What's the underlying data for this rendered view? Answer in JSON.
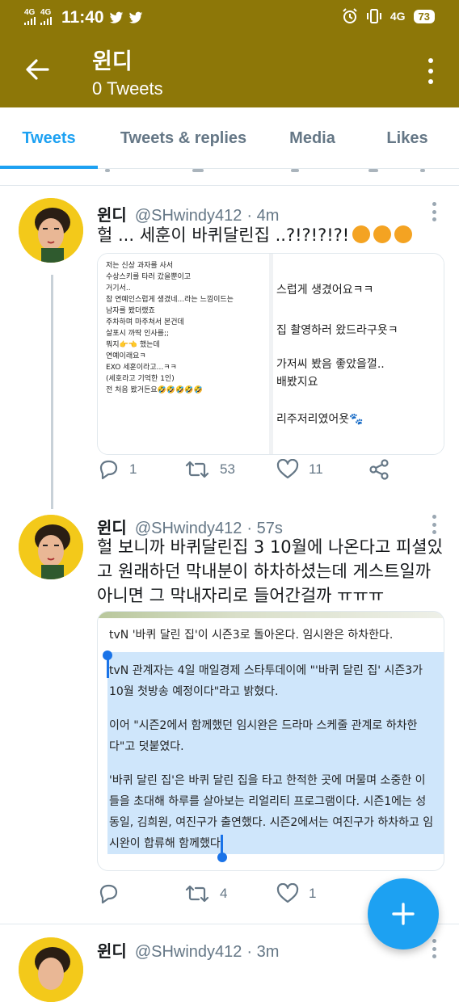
{
  "status_bar": {
    "net1": "4G",
    "net2": "4G",
    "time": "11:40",
    "net3": "4G",
    "battery": "73"
  },
  "header": {
    "title": "윈디",
    "subtitle": "0 Tweets"
  },
  "tabs": [
    {
      "label": "Tweets",
      "active": true
    },
    {
      "label": "Tweets & replies",
      "active": false
    },
    {
      "label": "Media",
      "active": false
    },
    {
      "label": "Likes",
      "active": false
    }
  ],
  "tweets": [
    {
      "name": "윈디",
      "handle": "@SHwindy412",
      "time": "· 4m",
      "text": "헐 ... 세훈이 바퀴달린집 ..?!?!?!?!",
      "emojis": [
        "yawning-face",
        "yawning-face",
        "yawning-face"
      ],
      "media_left_lines": [
        "저는 신상 과자를 사서",
        "수상스키를 타러 갔을뿐이고",
        "",
        "거기서..",
        "참 연예인스럽게 생겼네...라는 느낌이드는",
        "남자를 봤더랬죠",
        "",
        "주차하며 마주쳐서 본건데",
        "살포시 까딱 인사를;;",
        "",
        "뭐지👉👈 했는데",
        "연예이래요ㅋ",
        "",
        "EXO 세훈이라고...ㅋㅋ",
        "(세호라고 기억한 1인)",
        "전 처음 봤거든요🤣🤣🤣🤣🤣"
      ],
      "media_right_lines": [
        "스럽게 생겼어요ㅋㅋ",
        "집 촬영하러 왔드라구욧ㅋ",
        "가저씨 봤음 좋았을껄..",
        "배봤지요",
        "리주저리였어욧🐾"
      ],
      "replies": "1",
      "retweets": "53",
      "likes": "11"
    },
    {
      "name": "윈디",
      "handle": "@SHwindy412",
      "time": "· 57s",
      "text_lines": [
        "헐 보니까 바퀴달린집 3 10월에 나온다고 피셜있",
        "고 원래하던 막내분이 하차하셨는데  게스트일까",
        "아니면 그 막내자리로 들어간걸까 ㅠㅠㅠ"
      ],
      "card_title": "tvN '바퀴 달린 집'이 시즌3로 돌아온다. 임시완은 하차한다.",
      "card_paragraphs": [
        [
          "tvN 관계자는 4일 매일경제 스타투데이에 \"'바퀴 달린 집' 시즌3가",
          "10월 첫방송 예정이다\"라고 밝혔다."
        ],
        [
          "이어 \"시즌2에서 함께했던 임시완은 드라마 스케줄 관계로 하차한",
          "다\"고 덧붙였다."
        ],
        [
          "'바퀴 달린 집'은 바퀴 달린 집을 타고 한적한 곳에 머물며 소중한 이",
          "들을 초대해 하루를 살아보는 리얼리티 프로그램이다. 시즌1에는 성",
          "동일, 김희원, 여진구가 출연했다. 시즌2에서는 여진구가 하차하고 임",
          "시완이 합류해 함께했다."
        ]
      ],
      "replies": "",
      "retweets": "4",
      "likes": "1"
    },
    {
      "name": "윈디",
      "handle": "@SHwindy412",
      "time": "· 3m"
    }
  ],
  "colors": {
    "header_bg": "#8d7708",
    "accent": "#1da1f2",
    "selection": "#cfe6fb"
  }
}
